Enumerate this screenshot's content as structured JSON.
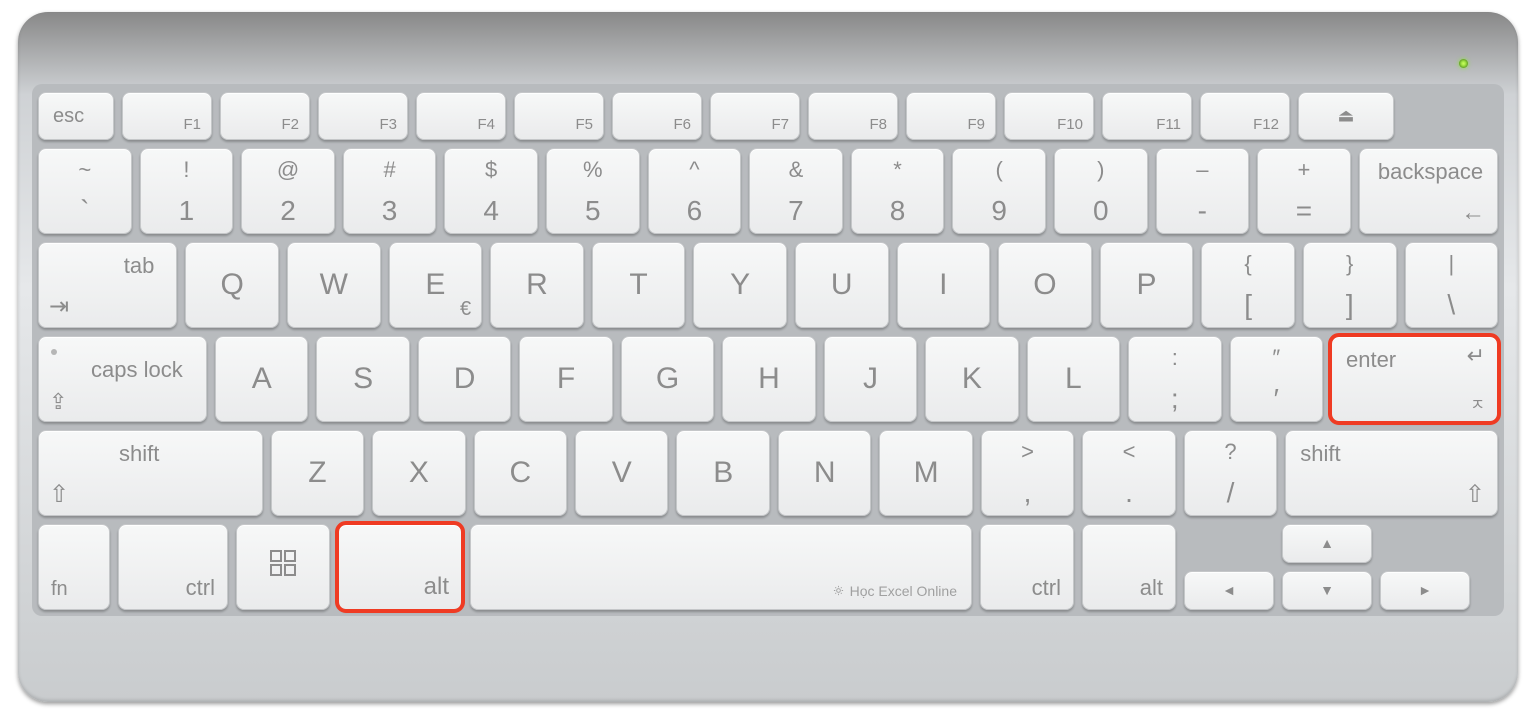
{
  "highlights": [
    "alt-left",
    "enter"
  ],
  "status_led": "green",
  "watermark": "Học Excel Online",
  "rows": {
    "function": {
      "esc": "esc",
      "f": [
        "F1",
        "F2",
        "F3",
        "F4",
        "F5",
        "F6",
        "F7",
        "F8",
        "F9",
        "F10",
        "F11",
        "F12"
      ],
      "eject": "⏏"
    },
    "number": {
      "keys": [
        {
          "top": "~",
          "bot": "`"
        },
        {
          "top": "!",
          "bot": "1"
        },
        {
          "top": "@",
          "bot": "2"
        },
        {
          "top": "#",
          "bot": "3"
        },
        {
          "top": "$",
          "bot": "4"
        },
        {
          "top": "%",
          "bot": "5"
        },
        {
          "top": "^",
          "bot": "6"
        },
        {
          "top": "&",
          "bot": "7"
        },
        {
          "top": "*",
          "bot": "8"
        },
        {
          "top": "(",
          "bot": "9"
        },
        {
          "top": ")",
          "bot": "0"
        },
        {
          "top": "–",
          "bot": "-"
        },
        {
          "top": "+",
          "bot": "="
        }
      ],
      "backspace": "backspace",
      "backspace_arrow": "←"
    },
    "qwerty": {
      "tab": "tab",
      "tab_sym": "⇥",
      "letters": [
        "Q",
        "W",
        "E",
        "R",
        "T",
        "Y",
        "U",
        "I",
        "O",
        "P"
      ],
      "e_extra": "€",
      "brackets": [
        {
          "top": "{",
          "bot": "["
        },
        {
          "top": "}",
          "bot": "]"
        },
        {
          "top": "|",
          "bot": "\\"
        }
      ]
    },
    "home": {
      "caps": "caps lock",
      "caps_sym": "⇪",
      "letters": [
        "A",
        "S",
        "D",
        "F",
        "G",
        "H",
        "J",
        "K",
        "L"
      ],
      "punct": [
        {
          "top": ":",
          "bot": ";"
        },
        {
          "top": "″",
          "bot": "′"
        }
      ],
      "enter": "enter",
      "enter_sym": "↵",
      "enter_sym2": "ㅈ"
    },
    "shift": {
      "shiftL": "shift",
      "shift_sym": "⇧",
      "letters": [
        "Z",
        "X",
        "C",
        "V",
        "B",
        "N",
        "M"
      ],
      "punct": [
        {
          "top": ">",
          "bot": ","
        },
        {
          "top": "<",
          "bot": "."
        },
        {
          "top": "?",
          "bot": "/"
        }
      ],
      "shiftR": "shift"
    },
    "bottom": {
      "fn": "fn",
      "ctrl": "ctrl",
      "win": "win",
      "altL": "alt",
      "space": "",
      "ctrlR": "ctrl",
      "altR": "alt",
      "arrows": {
        "left": "◄",
        "up": "▲",
        "down": "▼",
        "right": "►"
      }
    }
  }
}
